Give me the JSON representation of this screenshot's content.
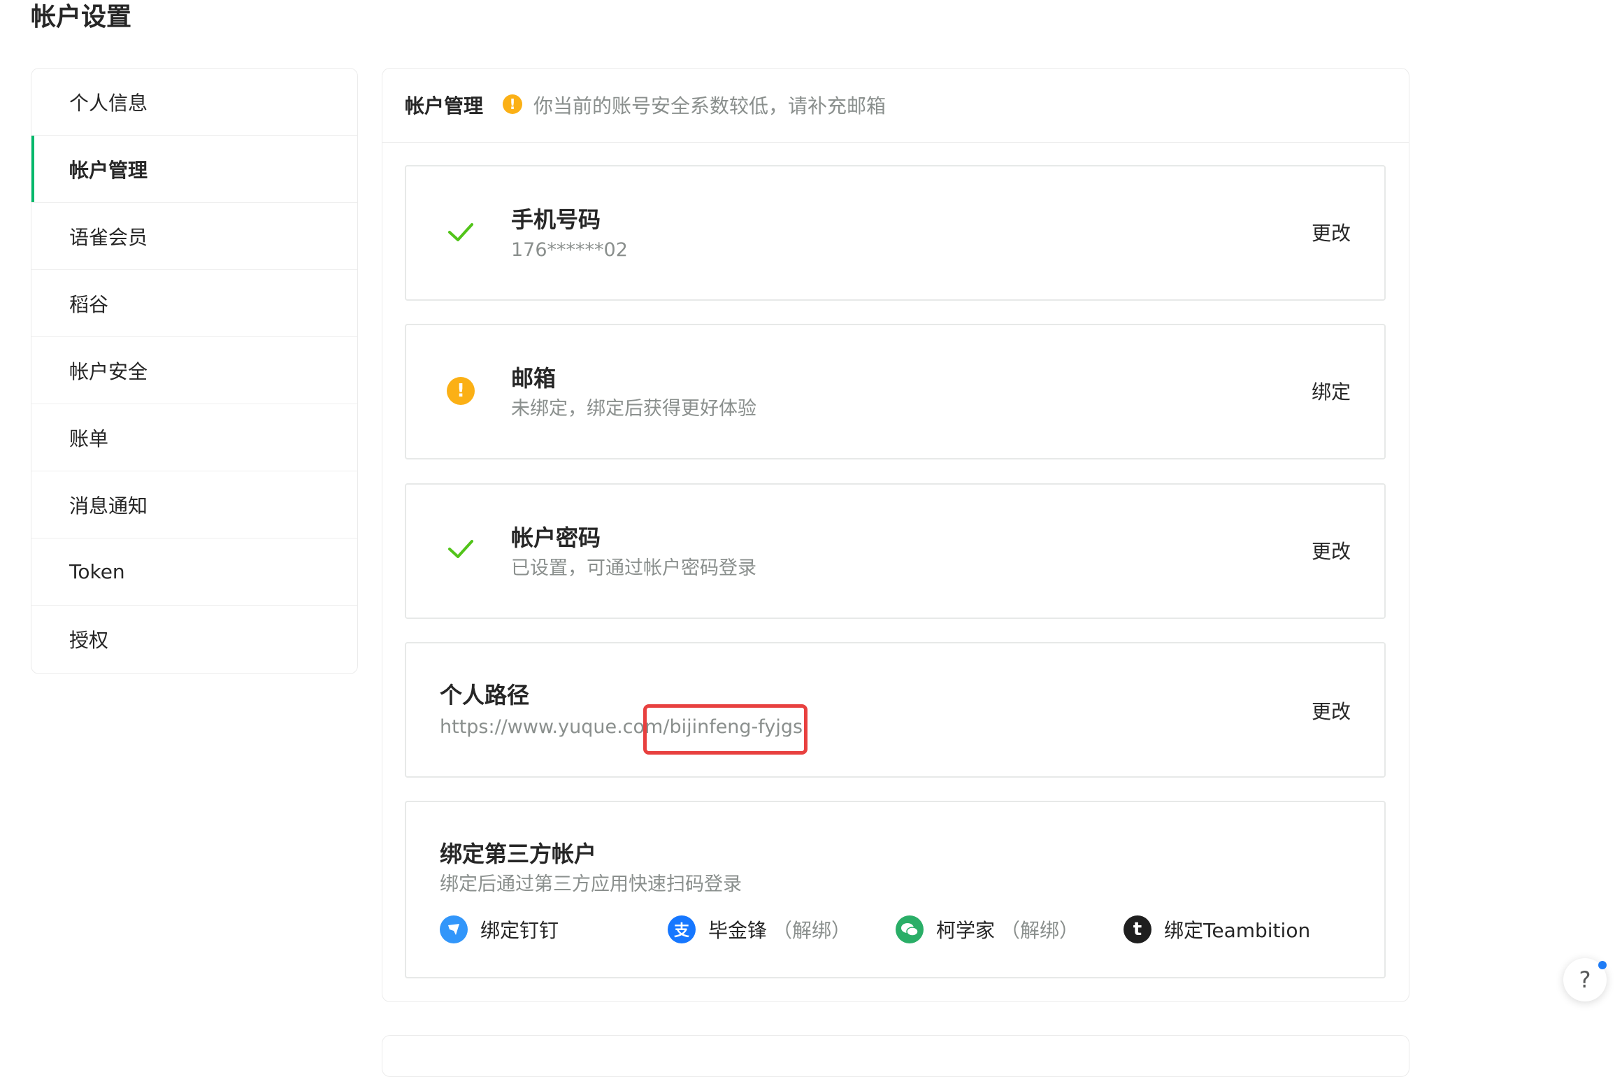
{
  "page": {
    "title": "帐户设置"
  },
  "sidebar": {
    "items": [
      {
        "label": "个人信息"
      },
      {
        "label": "帐户管理"
      },
      {
        "label": "语雀会员"
      },
      {
        "label": "稻谷"
      },
      {
        "label": "帐户安全"
      },
      {
        "label": "账单"
      },
      {
        "label": "消息通知"
      },
      {
        "label": "Token"
      },
      {
        "label": "授权"
      }
    ],
    "active_index": 1,
    "active_color": "#00b96b"
  },
  "main": {
    "header": {
      "title": "帐户管理",
      "warning": "你当前的账号安全系数较低，请补充邮箱"
    },
    "phone": {
      "title": "手机号码",
      "value": "176******02",
      "action": "更改",
      "status_icon": "check-icon"
    },
    "email": {
      "title": "邮箱",
      "desc": "未绑定，绑定后获得更好体验",
      "action": "绑定",
      "status_icon": "warning-icon"
    },
    "password": {
      "title": "帐户密码",
      "desc": "已设置，可通过帐户密码登录",
      "action": "更改",
      "status_icon": "check-icon"
    },
    "path": {
      "title": "个人路径",
      "url_prefix": "https://www.yuque.com/",
      "url_slug": "bijinfeng-fyjgs",
      "action": "更改"
    },
    "third_party": {
      "title": "绑定第三方帐户",
      "desc": "绑定后通过第三方应用快速扫码登录",
      "accounts": [
        {
          "icon": "dingtalk-icon",
          "label": "绑定钉钉",
          "unbind": ""
        },
        {
          "icon": "alipay-icon",
          "label": "毕金锋",
          "unbind": "（解绑）"
        },
        {
          "icon": "wechat-icon",
          "label": "柯学家",
          "unbind": "（解绑）"
        },
        {
          "icon": "teambition-icon",
          "label": "绑定Teambition",
          "unbind": ""
        }
      ]
    }
  },
  "help": {
    "label": "?"
  },
  "colors": {
    "success": "#52c41a",
    "warning": "#fbb015",
    "highlight": "#e8403f",
    "dingtalk": "#3296fa",
    "alipay": "#1677ff",
    "wechat": "#2aae67",
    "teambition": "#1f1f1f"
  }
}
